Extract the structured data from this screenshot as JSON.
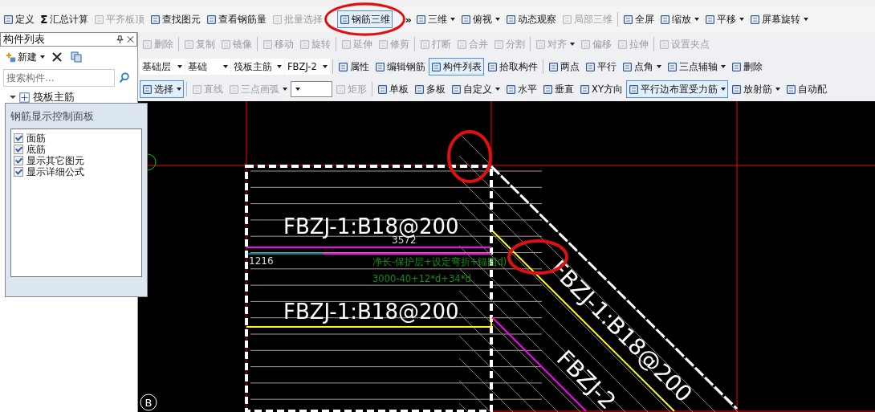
{
  "main_toolbar": [
    {
      "kind": "button",
      "label": "定义",
      "disabled": false,
      "selected": false
    },
    {
      "kind": "button",
      "label": "汇总计算",
      "glyph": "Σ",
      "disabled": false,
      "selected": false
    },
    {
      "kind": "button",
      "label": "平齐板顶",
      "disabled": true,
      "selected": false
    },
    {
      "kind": "button",
      "label": "查找图元",
      "disabled": false,
      "selected": false
    },
    {
      "kind": "button",
      "label": "查看钢筋量",
      "disabled": false,
      "selected": false
    },
    {
      "kind": "button",
      "label": "批量选择",
      "disabled": true,
      "selected": false
    },
    {
      "kind": "button",
      "label": "钢筋三维",
      "disabled": false,
      "selected": true
    },
    {
      "kind": "chevron",
      "label": "»"
    },
    {
      "kind": "button",
      "label": "三维",
      "dropdown": true,
      "disabled": false,
      "selected": false
    },
    {
      "kind": "button",
      "label": "俯视",
      "dropdown": true,
      "disabled": false,
      "selected": false
    },
    {
      "kind": "button",
      "label": "动态观察",
      "disabled": false,
      "selected": false
    },
    {
      "kind": "button",
      "label": "局部三维",
      "disabled": true,
      "selected": false
    },
    {
      "kind": "separator"
    },
    {
      "kind": "button",
      "label": "全屏",
      "disabled": false,
      "selected": false
    },
    {
      "kind": "button",
      "label": "缩放",
      "dropdown": true,
      "disabled": false,
      "selected": false
    },
    {
      "kind": "button",
      "label": "平移",
      "dropdown": true,
      "disabled": false,
      "selected": false
    },
    {
      "kind": "button",
      "label": "屏幕旋转",
      "dropdown": true,
      "disabled": false,
      "selected": false
    }
  ],
  "component_list": {
    "title": "构件列表",
    "new_button": "新建",
    "search": {
      "placeholder": "搜索构件..."
    },
    "tree": [
      {
        "label": "筏板主筋",
        "expanded": true
      }
    ]
  },
  "control_panel": {
    "title": "钢筋显示控制面板",
    "options": [
      {
        "label": "面筋",
        "checked": true
      },
      {
        "label": "底筋",
        "checked": true
      },
      {
        "label": "显示其它图元",
        "checked": true
      },
      {
        "label": "显示详细公式",
        "checked": true
      }
    ]
  },
  "toolbars": [
    [
      {
        "kind": "button",
        "label": "删除",
        "disabled": true,
        "selected": false
      },
      {
        "kind": "separator"
      },
      {
        "kind": "button",
        "label": "复制",
        "disabled": true,
        "selected": false
      },
      {
        "kind": "button",
        "label": "镜像",
        "disabled": true,
        "selected": false
      },
      {
        "kind": "separator"
      },
      {
        "kind": "button",
        "label": "移动",
        "disabled": true,
        "selected": false
      },
      {
        "kind": "button",
        "label": "旋转",
        "disabled": true,
        "selected": false
      },
      {
        "kind": "separator"
      },
      {
        "kind": "button",
        "label": "延伸",
        "disabled": true,
        "selected": false
      },
      {
        "kind": "button",
        "label": "修剪",
        "disabled": true,
        "selected": false
      },
      {
        "kind": "separator"
      },
      {
        "kind": "button",
        "label": "打断",
        "disabled": true,
        "selected": false
      },
      {
        "kind": "button",
        "label": "合并",
        "disabled": true,
        "selected": false
      },
      {
        "kind": "button",
        "label": "分割",
        "disabled": true,
        "selected": false
      },
      {
        "kind": "separator"
      },
      {
        "kind": "button",
        "label": "对齐",
        "dropdown": true,
        "disabled": true,
        "selected": false
      },
      {
        "kind": "button",
        "label": "偏移",
        "disabled": true,
        "selected": false
      },
      {
        "kind": "button",
        "label": "拉伸",
        "disabled": true,
        "selected": false
      },
      {
        "kind": "separator"
      },
      {
        "kind": "button",
        "label": "设置夹点",
        "disabled": true,
        "selected": false
      }
    ],
    [
      {
        "kind": "combo",
        "label": "基础层"
      },
      {
        "kind": "combo",
        "label": "基础"
      },
      {
        "kind": "combo",
        "label": "筏板主筋"
      },
      {
        "kind": "combo",
        "label": "FBZJ-2"
      },
      {
        "kind": "separator"
      },
      {
        "kind": "button",
        "label": "属性",
        "disabled": false,
        "selected": false
      },
      {
        "kind": "button",
        "label": "编辑钢筋",
        "disabled": false,
        "selected": false
      },
      {
        "kind": "button",
        "label": "构件列表",
        "disabled": false,
        "selected": true
      },
      {
        "kind": "button",
        "label": "拾取构件",
        "disabled": false,
        "selected": false
      },
      {
        "kind": "separator"
      },
      {
        "kind": "button",
        "label": "两点",
        "disabled": false,
        "selected": false
      },
      {
        "kind": "button",
        "label": "平行",
        "disabled": false,
        "selected": false
      },
      {
        "kind": "button",
        "label": "点角",
        "dropdown": true,
        "disabled": false,
        "selected": false
      },
      {
        "kind": "button",
        "label": "三点辅轴",
        "dropdown": true,
        "disabled": false,
        "selected": false
      },
      {
        "kind": "button",
        "label": "删除",
        "disabled": false,
        "selected": false
      }
    ],
    [
      {
        "kind": "button",
        "label": "选择",
        "dropdown": true,
        "disabled": false,
        "selected": true
      },
      {
        "kind": "separator"
      },
      {
        "kind": "button",
        "label": "直线",
        "disabled": true,
        "selected": false
      },
      {
        "kind": "button",
        "label": "三点画弧",
        "dropdown": true,
        "disabled": true,
        "selected": false
      },
      {
        "kind": "combo"
      },
      {
        "kind": "button",
        "label": "矩形",
        "disabled": true,
        "selected": false
      },
      {
        "kind": "separator"
      },
      {
        "kind": "button",
        "label": "单板",
        "disabled": false,
        "selected": false
      },
      {
        "kind": "button",
        "label": "多板",
        "disabled": false,
        "selected": false
      },
      {
        "kind": "button",
        "label": "自定义",
        "dropdown": true,
        "disabled": false,
        "selected": false
      },
      {
        "kind": "button",
        "label": "水平",
        "disabled": false,
        "selected": false
      },
      {
        "kind": "button",
        "label": "垂直",
        "disabled": false,
        "selected": false
      },
      {
        "kind": "button",
        "label": "XY方向",
        "disabled": false,
        "selected": false
      },
      {
        "kind": "button",
        "label": "平行边布置受力筋",
        "dropdown": true,
        "disabled": false,
        "selected": true
      },
      {
        "kind": "button",
        "label": "放射筋",
        "dropdown": true,
        "disabled": false,
        "selected": false
      },
      {
        "kind": "button",
        "label": "自动配",
        "disabled": false,
        "selected": false
      }
    ]
  ],
  "canvas": {
    "labels": [
      {
        "kind": "rebar",
        "text": "FBZJ-1:B18@200"
      },
      {
        "kind": "dimension",
        "text": "3572"
      },
      {
        "kind": "dimension",
        "text": "1216"
      },
      {
        "kind": "formula",
        "text": "净长-保护层+设定弯折+锚固d)"
      },
      {
        "kind": "formula",
        "text": "3000-40+12*d+34*d"
      },
      {
        "kind": "rebar",
        "text": "FBZJ-1:B18@200"
      },
      {
        "kind": "rotated",
        "text": "FBZJ-1:B18@200"
      },
      {
        "kind": "rotated",
        "text": "FBZJ-2"
      },
      {
        "kind": "axis",
        "text": "B"
      }
    ]
  }
}
